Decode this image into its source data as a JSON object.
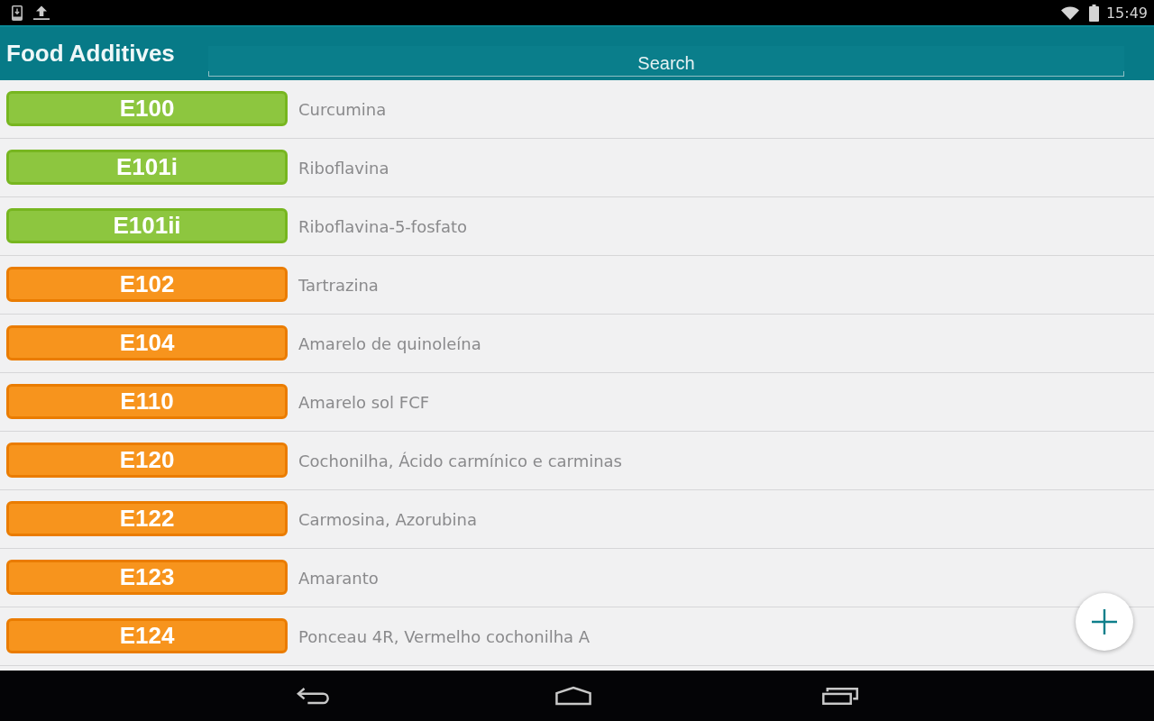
{
  "status_bar": {
    "time": "15:49"
  },
  "app_bar": {
    "title": "Food Additives",
    "search": {
      "placeholder": "Search"
    }
  },
  "additives": [
    {
      "code": "E100",
      "name": "Curcumina",
      "color": "#8dc63f"
    },
    {
      "code": "E101i",
      "name": "Riboflavina",
      "color": "#8dc63f"
    },
    {
      "code": "E101ii",
      "name": "Riboflavina-5-fosfato",
      "color": "#8dc63f"
    },
    {
      "code": "E102",
      "name": "Tartrazina",
      "color": "#f7941d"
    },
    {
      "code": "E104",
      "name": "Amarelo de quinoleína",
      "color": "#f7941d"
    },
    {
      "code": "E110",
      "name": "Amarelo sol FCF",
      "color": "#f7941d"
    },
    {
      "code": "E120",
      "name": "Cochonilha, Ácido carmínico e carminas",
      "color": "#f7941d"
    },
    {
      "code": "E122",
      "name": "Carmosina, Azorubina",
      "color": "#f7941d"
    },
    {
      "code": "E123",
      "name": "Amaranto",
      "color": "#f7941d"
    },
    {
      "code": "E124",
      "name": "Ponceau 4R, Vermelho cochonilha A",
      "color": "#f7941d"
    }
  ]
}
